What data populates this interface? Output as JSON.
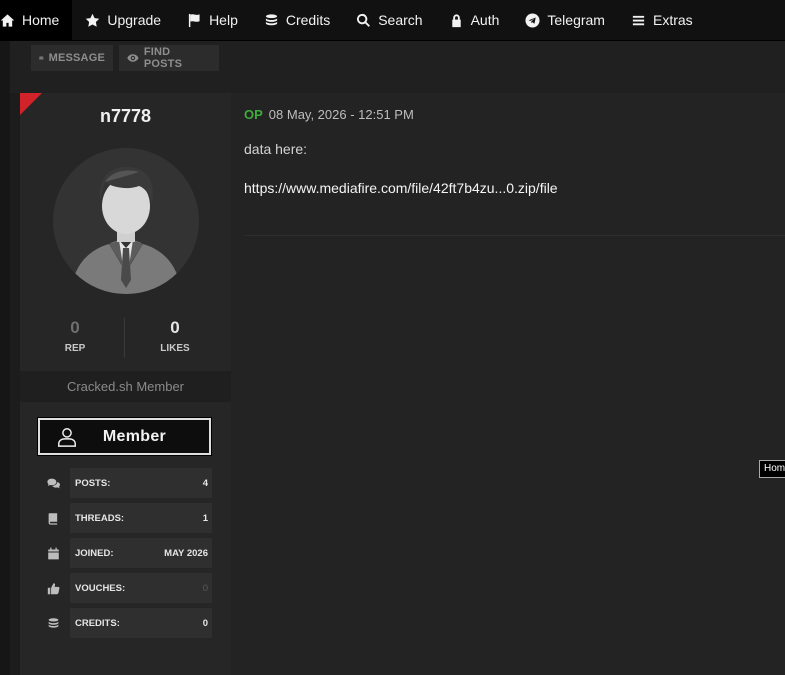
{
  "nav": {
    "items": [
      {
        "label": "Home",
        "icon": "home-icon"
      },
      {
        "label": "Upgrade",
        "icon": "star-icon"
      },
      {
        "label": "Help",
        "icon": "flag-icon"
      },
      {
        "label": "Credits",
        "icon": "coins-icon"
      },
      {
        "label": "Search",
        "icon": "search-icon"
      },
      {
        "label": "Auth",
        "icon": "lock-icon"
      },
      {
        "label": "Telegram",
        "icon": "telegram-icon"
      },
      {
        "label": "Extras",
        "icon": "menu-icon"
      }
    ]
  },
  "toolbar": {
    "message_label": "MESSAGE",
    "find_posts_label": "FIND POSTS"
  },
  "user": {
    "username": "n7778",
    "rep_value": "0",
    "rep_label": "REP",
    "likes_value": "0",
    "likes_label": "LIKES",
    "member_title": "Cracked.sh Member",
    "rank_label": "Member",
    "stats": [
      {
        "label": "POSTS:",
        "value": "4",
        "icon": "comments-icon"
      },
      {
        "label": "THREADS:",
        "value": "1",
        "icon": "book-icon"
      },
      {
        "label": "JOINED:",
        "value": "MAY 2026",
        "icon": "calendar-icon"
      },
      {
        "label": "VOUCHES:",
        "value": "0",
        "icon": "thumbs-up-icon"
      },
      {
        "label": "CREDITS:",
        "value": "0",
        "icon": "coins-icon"
      }
    ]
  },
  "post": {
    "op_badge": "OP",
    "date": "08 May, 2026 - 12:51 PM",
    "line1": "data here:",
    "line2": "https://www.mediafire.com/file/42ft7b4zu...0.zip/file"
  },
  "tooltip": "Home",
  "colors": {
    "accent_red": "#d3232a",
    "op_green": "#3dac3b"
  }
}
